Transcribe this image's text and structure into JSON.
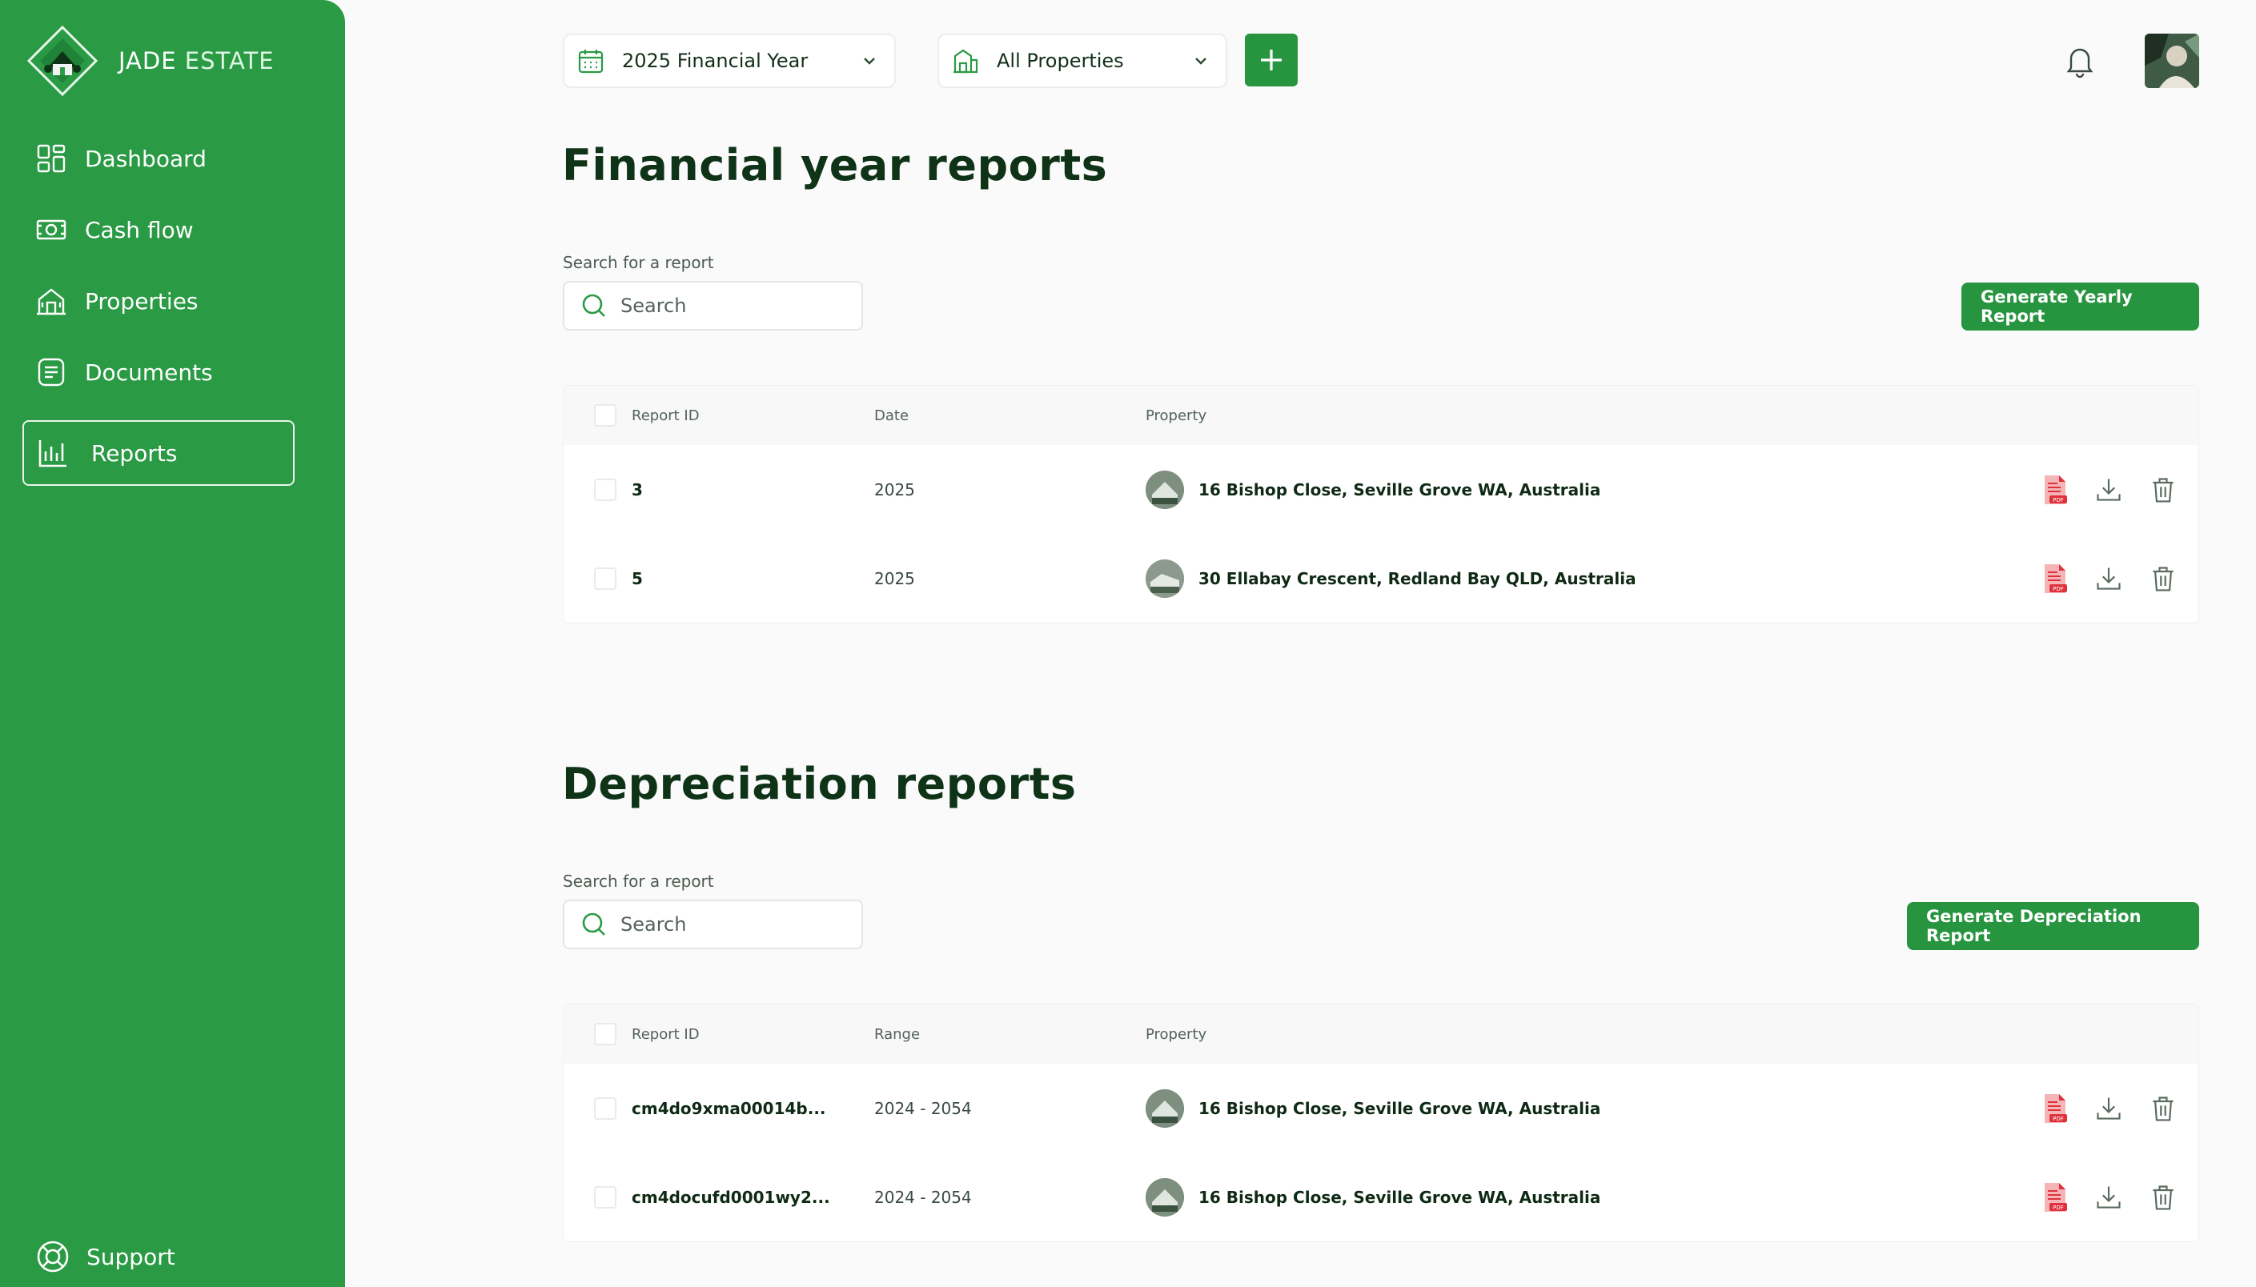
{
  "brand": {
    "name_primary": "JADE",
    "name_secondary": "ESTATE"
  },
  "sidebar": {
    "items": [
      {
        "label": "Dashboard",
        "icon": "dashboard-icon"
      },
      {
        "label": "Cash flow",
        "icon": "cash-icon"
      },
      {
        "label": "Properties",
        "icon": "properties-icon"
      },
      {
        "label": "Documents",
        "icon": "documents-icon"
      },
      {
        "label": "Reports",
        "icon": "reports-icon",
        "active": true
      }
    ],
    "support_label": "Support"
  },
  "topbar": {
    "year_select": "2025 Financial Year",
    "property_select": "All Properties"
  },
  "financial": {
    "title": "Financial year reports",
    "search_label": "Search for a report",
    "search_placeholder": "Search",
    "generate_label": "Generate Yearly Report",
    "columns": {
      "id": "Report ID",
      "date": "Date",
      "property": "Property"
    },
    "rows": [
      {
        "id": "3",
        "date": "2025",
        "property": "16 Bishop Close, Seville Grove WA, Australia"
      },
      {
        "id": "5",
        "date": "2025",
        "property": "30 Ellabay Crescent, Redland Bay QLD, Australia"
      }
    ]
  },
  "depreciation": {
    "title": "Depreciation reports",
    "search_label": "Search for a report",
    "search_placeholder": "Search",
    "generate_label": "Generate Depreciation Report",
    "columns": {
      "id": "Report ID",
      "range": "Range",
      "property": "Property"
    },
    "rows": [
      {
        "id": "cm4do9xma00014b...",
        "range": "2024 - 2054",
        "property": "16 Bishop Close, Seville Grove WA, Australia"
      },
      {
        "id": "cm4docufd0001wy2...",
        "range": "2024 - 2054",
        "property": "16 Bishop Close, Seville Grove WA, Australia"
      }
    ]
  },
  "colors": {
    "brand_green": "#2a9a44",
    "button_green": "#27953f",
    "heading": "#0f3317",
    "pdf_red": "#e0323c"
  }
}
